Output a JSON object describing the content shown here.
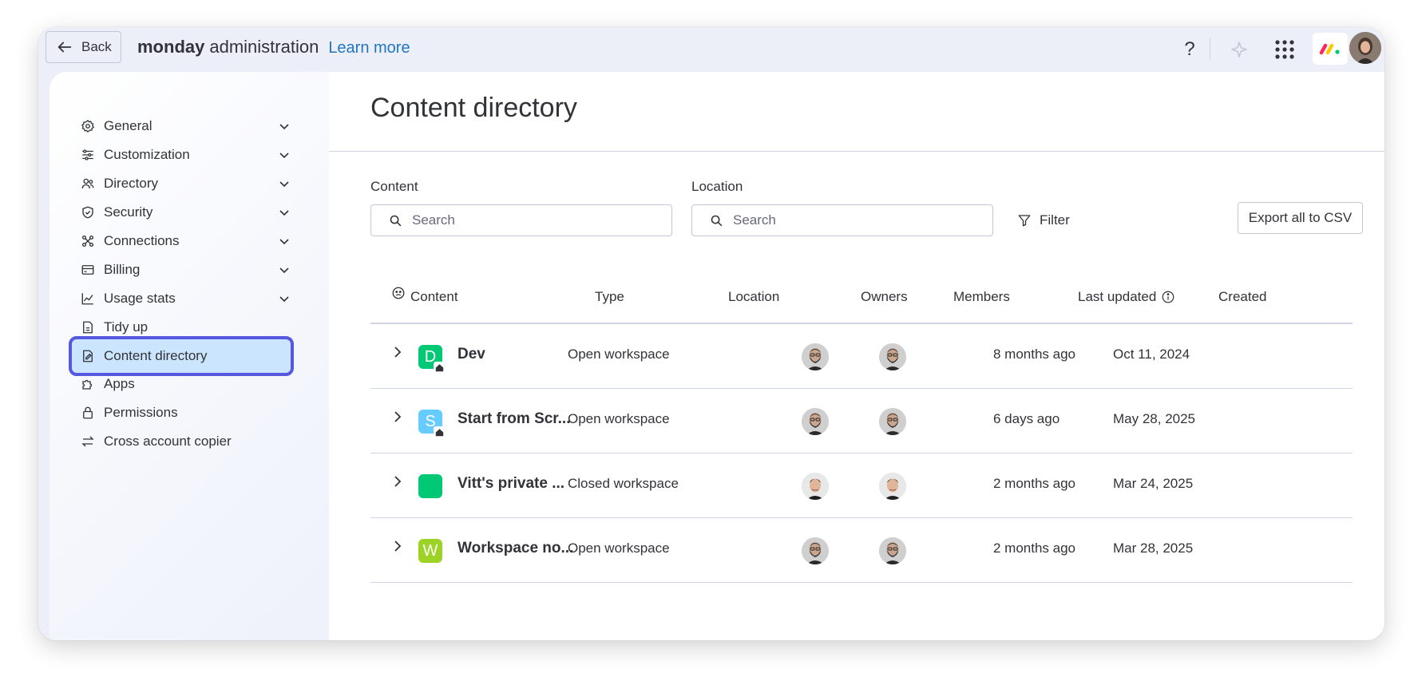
{
  "topbar": {
    "back_label": "Back",
    "brand_bold": "monday",
    "brand_rest": "administration",
    "learn_more": "Learn more",
    "help_glyph": "?",
    "icons": [
      "arrow-left-icon",
      "help-icon",
      "sparkle-icon",
      "apps-grid-icon",
      "monday-logo-icon",
      "user-avatar"
    ]
  },
  "sidebar": {
    "items": [
      {
        "label": "General",
        "icon": "gear-icon",
        "expandable": true
      },
      {
        "label": "Customization",
        "icon": "sliders-icon",
        "expandable": true
      },
      {
        "label": "Directory",
        "icon": "people-icon",
        "expandable": true
      },
      {
        "label": "Security",
        "icon": "shield-icon",
        "expandable": true
      },
      {
        "label": "Connections",
        "icon": "connections-icon",
        "expandable": true
      },
      {
        "label": "Billing",
        "icon": "credit-card-icon",
        "expandable": true
      },
      {
        "label": "Usage stats",
        "icon": "chart-icon",
        "expandable": true
      },
      {
        "label": "Tidy up",
        "icon": "broom-icon",
        "expandable": false
      },
      {
        "label": "Content directory",
        "icon": "document-icon",
        "expandable": false,
        "active": true
      },
      {
        "label": "Apps",
        "icon": "puzzle-icon",
        "expandable": false
      },
      {
        "label": "Permissions",
        "icon": "lock-icon",
        "expandable": false
      },
      {
        "label": "Cross account copier",
        "icon": "swap-icon",
        "expandable": false
      }
    ]
  },
  "main": {
    "title": "Content directory",
    "content_label": "Content",
    "content_placeholder": "Search",
    "location_label": "Location",
    "location_placeholder": "Search",
    "filter_label": "Filter",
    "export_label": "Export all to CSV"
  },
  "table": {
    "headers": {
      "content": "Content",
      "type": "Type",
      "location": "Location",
      "owners": "Owners",
      "members": "Members",
      "last_updated": "Last updated",
      "created": "Created"
    },
    "rows": [
      {
        "letter": "D",
        "color": "#00c875",
        "home": true,
        "name": "Dev",
        "type": "Open workspace",
        "location": "",
        "owner_face": "bearded",
        "member_face": "bearded",
        "last_updated": "8 months ago",
        "created": "Oct 11, 2024"
      },
      {
        "letter": "S",
        "color": "#66ccff",
        "home": true,
        "name": "Start from Scr...",
        "type": "Open workspace",
        "location": "",
        "owner_face": "bearded",
        "member_face": "bearded",
        "last_updated": "6 days ago",
        "created": "May 28, 2025"
      },
      {
        "letter": "",
        "color": "#00c875",
        "home": false,
        "name": "Vitt's private ...",
        "type": "Closed workspace",
        "location": "",
        "owner_face": "young",
        "member_face": "young",
        "last_updated": "2 months ago",
        "created": "Mar 24, 2025"
      },
      {
        "letter": "W",
        "color": "#9cd326",
        "home": false,
        "name": "Workspace no...",
        "type": "Open workspace",
        "location": "",
        "owner_face": "bearded",
        "member_face": "bearded",
        "last_updated": "2 months ago",
        "created": "Mar 28, 2025"
      }
    ]
  },
  "colors": {
    "accent": "#5559df",
    "active_bg": "#cce5ff",
    "link": "#1f76c2",
    "border": "#d0d4e4"
  }
}
